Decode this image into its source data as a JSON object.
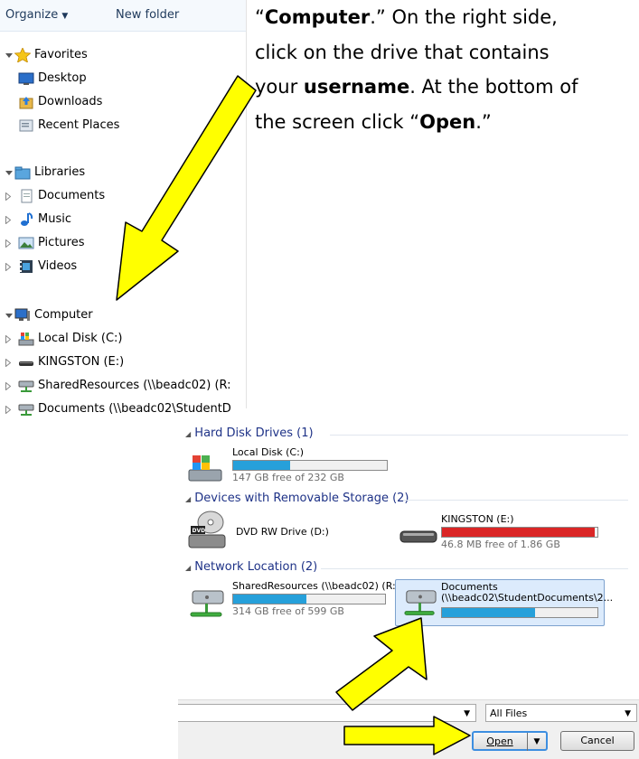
{
  "toolbar": {
    "organize_label": "Organize",
    "new_folder_label": "New folder"
  },
  "nav": {
    "favorites": {
      "label": "Favorites",
      "items": [
        {
          "label": "Desktop",
          "icon": "desktop-icon"
        },
        {
          "label": "Downloads",
          "icon": "downloads-icon"
        },
        {
          "label": "Recent Places",
          "icon": "recent-places-icon"
        }
      ]
    },
    "libraries": {
      "label": "Libraries",
      "items": [
        {
          "label": "Documents",
          "icon": "documents-icon"
        },
        {
          "label": "Music",
          "icon": "music-icon"
        },
        {
          "label": "Pictures",
          "icon": "pictures-icon"
        },
        {
          "label": "Videos",
          "icon": "videos-icon"
        }
      ]
    },
    "computer": {
      "label": "Computer",
      "items": [
        {
          "label": "Local Disk (C:)",
          "icon": "local-disk-icon"
        },
        {
          "label": "KINGSTON (E:)",
          "icon": "usb-drive-icon"
        },
        {
          "label": "SharedResources (\\\\beadc02) (R:",
          "icon": "network-drive-icon"
        },
        {
          "label": "Documents (\\\\beadc02\\StudentD",
          "icon": "network-drive-icon"
        }
      ]
    }
  },
  "instruction": {
    "line1_bold": "Computer",
    "line1_rest": ".” On the right side,",
    "line2": "click on the drive that contains",
    "line3_pre": "your ",
    "line3_bold": "username",
    "line3_rest": ".  At the bottom of",
    "line4_pre": "the screen click “",
    "line4_bold": "Open",
    "line4_rest": ".”",
    "open_quote": "“"
  },
  "panel": {
    "groups": {
      "hdd": "Hard Disk Drives (1)",
      "removable": "Devices with Removable Storage (2)",
      "network": "Network Location (2)"
    },
    "drives": {
      "c": {
        "name": "Local Disk (C:)",
        "free": "147 GB free of 232 GB",
        "used_fraction": 0.37
      },
      "dvd": {
        "name": "DVD RW Drive (D:)"
      },
      "e": {
        "name": "KINGSTON (E:)",
        "free": "46.8 MB free of 1.86 GB",
        "used_fraction": 0.98
      },
      "r": {
        "name": "SharedResources (\\\\beadc02) (R:)",
        "free": "314 GB free of 599 GB",
        "used_fraction": 0.48
      },
      "docs": {
        "name": "Documents",
        "path": "(\\\\beadc02\\StudentDocuments\\2...",
        "used_fraction": 0.6
      }
    },
    "filter": {
      "value": "All Files"
    },
    "buttons": {
      "open": "Open",
      "cancel": "Cancel"
    }
  },
  "colors": {
    "bar_normal": "#26a0da",
    "bar_full": "#da2626",
    "arrow_fill": "#ffff00",
    "group_header": "#1e3287"
  }
}
